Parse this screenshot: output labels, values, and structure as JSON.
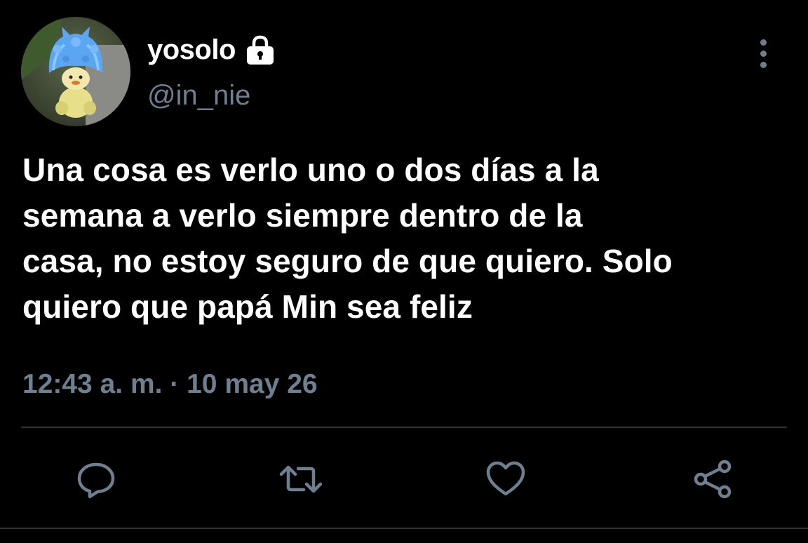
{
  "user": {
    "display_name": "yosolo",
    "handle": "@in_nie",
    "protected_icon": "lock-icon",
    "avatar_icon": "avatar"
  },
  "tweet": {
    "text": "Una cosa es verlo uno o dos días a la\nsemana a verlo siempre dentro de la\ncasa, no estoy seguro de que quiero. Solo\nquiero que papá Min sea feliz",
    "timestamp": "12:43 a. m. · 10 may 26"
  },
  "actions": [
    {
      "icon": "reply-icon"
    },
    {
      "icon": "retweet-icon"
    },
    {
      "icon": "like-icon"
    },
    {
      "icon": "share-icon"
    }
  ],
  "menu": {
    "icon": "more-vertical-icon"
  },
  "colors": {
    "background": "#000000",
    "text": "#ffffff",
    "secondary": "#6e7f8f",
    "divider": "#2f3336"
  }
}
